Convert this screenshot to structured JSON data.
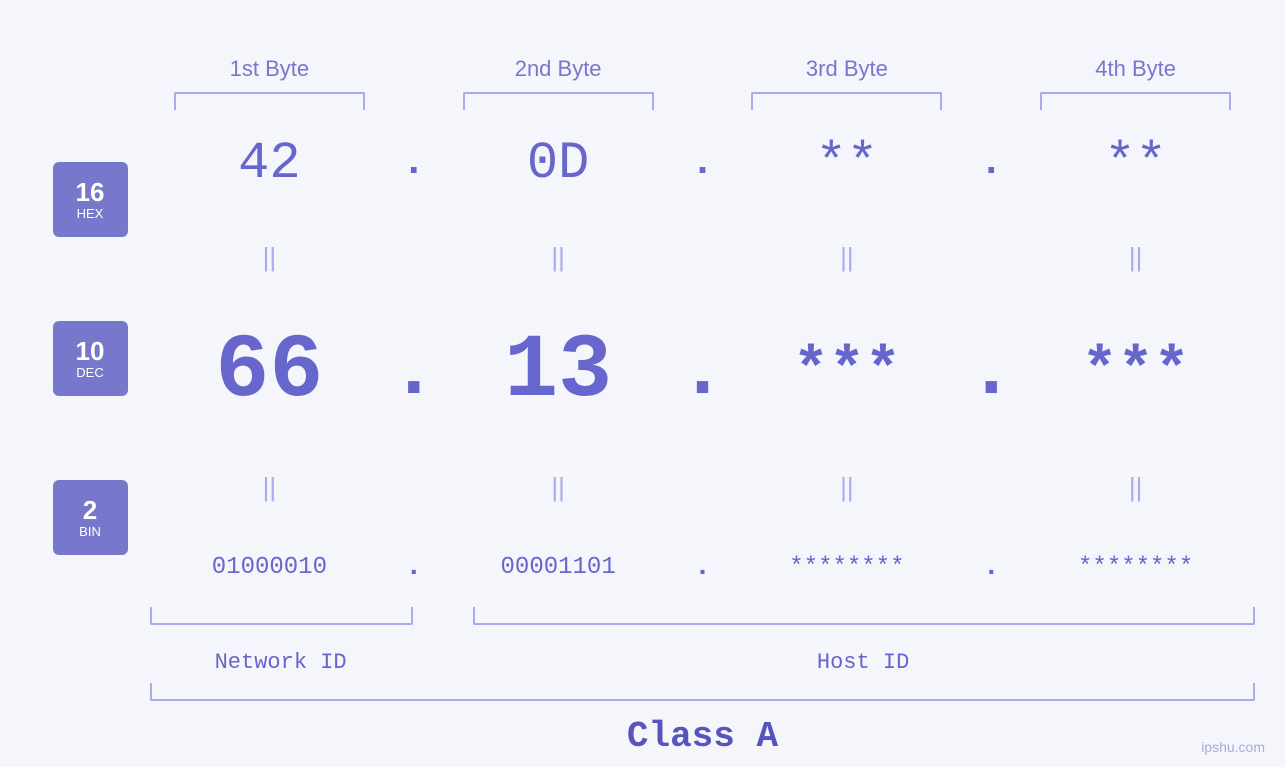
{
  "header": {
    "bytes": [
      {
        "label": "1st Byte"
      },
      {
        "label": "2nd Byte"
      },
      {
        "label": "3rd Byte"
      },
      {
        "label": "4th Byte"
      }
    ]
  },
  "badges": [
    {
      "num": "16",
      "label": "HEX"
    },
    {
      "num": "10",
      "label": "DEC"
    },
    {
      "num": "2",
      "label": "BIN"
    }
  ],
  "rows": {
    "hex": {
      "values": [
        "42",
        "0D",
        "**",
        "**"
      ],
      "dots": [
        ".",
        ".",
        ".",
        "."
      ]
    },
    "dec": {
      "values": [
        "66",
        "13",
        "***",
        "***"
      ],
      "dots": [
        ".",
        ".",
        ".",
        "."
      ]
    },
    "bin": {
      "values": [
        "01000010",
        "00001101",
        "********",
        "********"
      ],
      "dots": [
        ".",
        ".",
        ".",
        "."
      ]
    }
  },
  "labels": {
    "network_id": "Network ID",
    "host_id": "Host ID",
    "class": "Class A"
  },
  "watermark": "ipshu.com"
}
